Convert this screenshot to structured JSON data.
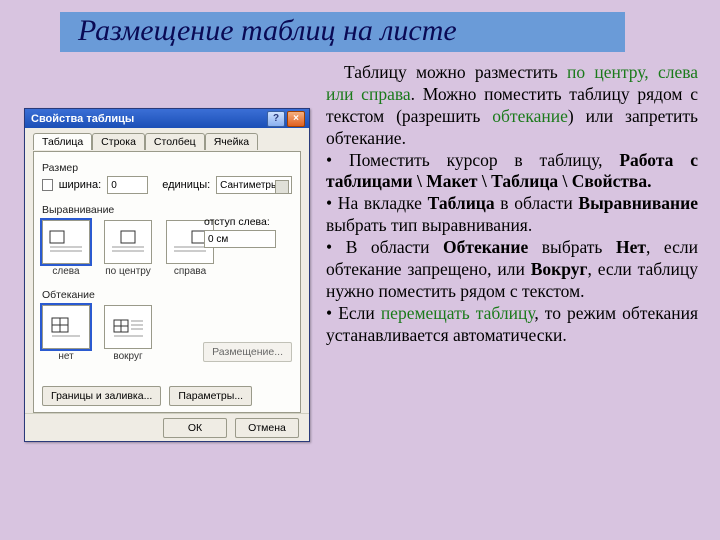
{
  "title": "Размещение таблиц на листе",
  "paragraph": {
    "l1a": "Таблицу можно разместить ",
    "l1b": "по центру, слева или справа",
    "l1c": ". Можно поместить таблицу рядом с текстом (разрешить ",
    "l1d": "обтекание",
    "l1e": ") или запретить обтекание.",
    "b1a": "• Поместить курсор в таблицу, ",
    "b1b": "Работа с таблицами \\ Макет \\ Таблица \\ Свойства.",
    "b2a": "• На вкладке ",
    "b2b": "Таблица",
    "b2c": " в области ",
    "b2d": "Выравнивание",
    "b2e": " выбрать тип выравнивания.",
    "b3a": "• В области ",
    "b3b": "Обтекание",
    "b3c": " выбрать ",
    "b3d": "Нет",
    "b3e": ", если обтекание запрещено, или ",
    "b3f": "Вокруг",
    "b3g": ", если таблицу нужно поместить рядом с текстом.",
    "b4a": "• Если ",
    "b4b": "перемещать таблицу",
    "b4c": ", то режим обтекания устанавливается автоматически."
  },
  "dlg": {
    "title": "Свойства таблицы",
    "help": "?",
    "close": "×",
    "tabs": [
      "Таблица",
      "Строка",
      "Столбец",
      "Ячейка"
    ],
    "size_group": "Размер",
    "width_label": "ширина:",
    "width_value": "0",
    "units_label": "единицы:",
    "units_value": "Сантиметры",
    "align_group": "Выравнивание",
    "align_captions": [
      "слева",
      "по центру",
      "справа"
    ],
    "indent_label": "отступ слева:",
    "indent_value": "0 см",
    "wrap_group": "Обтекание",
    "wrap_captions": [
      "нет",
      "вокруг"
    ],
    "place_btn": "Размещение...",
    "borders_btn": "Границы и заливка...",
    "params_btn": "Параметры...",
    "ok": "ОК",
    "cancel": "Отмена"
  }
}
